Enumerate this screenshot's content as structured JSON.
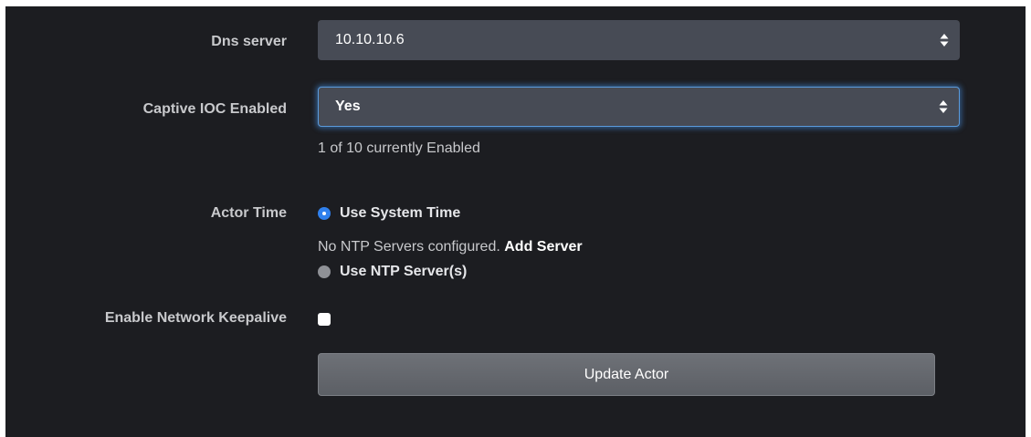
{
  "form": {
    "dns_server": {
      "label": "Dns server",
      "value": "10.10.10.6"
    },
    "captive_ioc": {
      "label": "Captive IOC Enabled",
      "value": "Yes",
      "helper": "1 of 10 currently Enabled"
    },
    "actor_time": {
      "label": "Actor Time",
      "option_system": "Use System Time",
      "ntp_note": "No NTP Servers configured.",
      "add_server_link": "Add Server",
      "option_ntp": "Use NTP Server(s)",
      "selected": "Use System Time"
    },
    "network_keepalive": {
      "label": "Enable Network Keepalive",
      "checked": false
    },
    "submit_label": "Update Actor"
  },
  "colors": {
    "panel_bg": "#1c1d21",
    "select_bg": "#474b55",
    "accent": "#2f80ed",
    "focus_border": "#5b9bdc"
  },
  "icons": {
    "select_arrows": "sort-updown-icon"
  }
}
